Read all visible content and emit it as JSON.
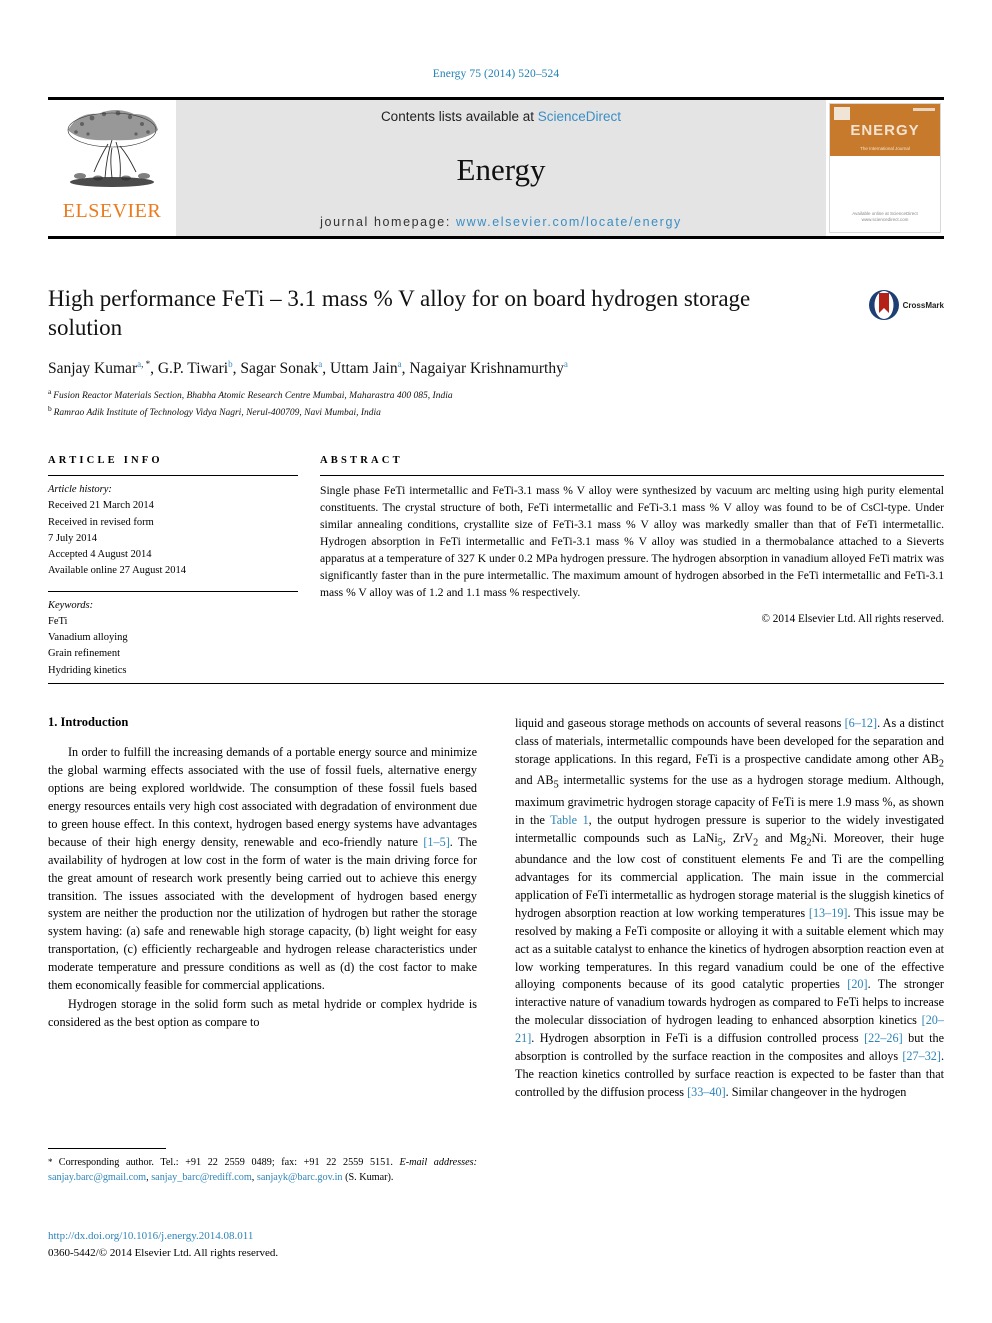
{
  "running_head": "Energy 75 (2014) 520–524",
  "masthead": {
    "publisher": "ELSEVIER",
    "contents_prefix": "Contents lists available at ",
    "contents_link": "ScienceDirect",
    "journal_name": "Energy",
    "homepage_prefix": "journal homepage: ",
    "homepage_url": "www.elsevier.com/locate/energy",
    "cover": {
      "title": "ENERGY",
      "subtitle": "The International Journal",
      "footer": "Available online at\nScienceDirect\nwww.sciencedirect.com"
    }
  },
  "article": {
    "title": "High performance FeTi – 3.1 mass % V alloy for on board hydrogen storage solution",
    "crossmark_label": "CrossMark",
    "authors": [
      {
        "name": "Sanjay Kumar",
        "sup": "a",
        "star": true
      },
      {
        "name": "G.P. Tiwari",
        "sup": "b",
        "star": false
      },
      {
        "name": "Sagar Sonak",
        "sup": "a",
        "star": false
      },
      {
        "name": "Uttam Jain",
        "sup": "a",
        "star": false
      },
      {
        "name": "Nagaiyar Krishnamurthy",
        "sup": "a",
        "star": false
      }
    ],
    "affiliations": [
      {
        "mark": "a",
        "text": "Fusion Reactor Materials Section, Bhabha Atomic Research Centre Mumbai, Maharastra 400 085, India"
      },
      {
        "mark": "b",
        "text": "Ramrao Adik Institute of Technology Vidya Nagri, Nerul-400709, Navi Mumbai, India"
      }
    ]
  },
  "article_info": {
    "heading": "ARTICLE INFO",
    "history_label": "Article history:",
    "history": [
      "Received 21 March 2014",
      "Received in revised form",
      "7 July 2014",
      "Accepted 4 August 2014",
      "Available online 27 August 2014"
    ],
    "keywords_label": "Keywords:",
    "keywords": [
      "FeTi",
      "Vanadium alloying",
      "Grain refinement",
      "Hydriding kinetics"
    ]
  },
  "abstract": {
    "heading": "ABSTRACT",
    "text": "Single phase FeTi intermetallic and FeTi-3.1 mass % V alloy were synthesized by vacuum arc melting using high purity elemental constituents. The crystal structure of both, FeTi intermetallic and FeTi-3.1 mass % V alloy was found to be of CsCl-type. Under similar annealing conditions, crystallite size of FeTi-3.1 mass % V alloy was markedly smaller than that of FeTi intermetallic. Hydrogen absorption in FeTi intermetallic and FeTi-3.1 mass % V alloy was studied in a thermobalance attached to a Sieverts apparatus at a temperature of 327 K under 0.2 MPa hydrogen pressure. The hydrogen absorption in vanadium alloyed FeTi matrix was significantly faster than in the pure intermetallic. The maximum amount of hydrogen absorbed in the FeTi intermetallic and FeTi-3.1 mass % V alloy was of 1.2 and 1.1 mass % respectively.",
    "copyright": "© 2014 Elsevier Ltd. All rights reserved."
  },
  "body": {
    "section_title": "1. Introduction",
    "left_paragraphs": [
      "In order to fulfill the increasing demands of a portable energy source and minimize the global warming effects associated with the use of fossil fuels, alternative energy options are being explored worldwide. The consumption of these fossil fuels based energy resources entails very high cost associated with degradation of environment due to green house effect. In this context, hydrogen based energy systems have advantages because of their high energy density, renewable and eco-friendly nature [1–5]. The availability of hydrogen at low cost in the form of water is the main driving force for the great amount of research work presently being carried out to achieve this energy transition. The issues associated with the development of hydrogen based energy system are neither the production nor the utilization of hydrogen but rather the storage system having: (a) safe and renewable high storage capacity, (b) light weight for easy transportation, (c) efficiently rechargeable and hydrogen release characteristics under moderate temperature and pressure conditions as well as (d) the cost factor to make them economically feasible for commercial applications.",
      "Hydrogen storage in the solid form such as metal hydride or complex hydride is considered as the best option as compare to"
    ],
    "right_paragraphs": [
      "liquid and gaseous storage methods on accounts of several reasons [6–12]. As a distinct class of materials, intermetallic compounds have been developed for the separation and storage applications. In this regard, FeTi is a prospective candidate among other AB2 and AB5 intermetallic systems for the use as a hydrogen storage medium. Although, maximum gravimetric hydrogen storage capacity of FeTi is mere 1.9 mass %, as shown in the Table 1, the output hydrogen pressure is superior to the widely investigated intermetallic compounds such as LaNi5, ZrV2 and Mg2Ni. Moreover, their huge abundance and the low cost of constituent elements Fe and Ti are the compelling advantages for its commercial application. The main issue in the commercial application of FeTi intermetallic as hydrogen storage material is the sluggish kinetics of hydrogen absorption reaction at low working temperatures [13–19]. This issue may be resolved by making a FeTi composite or alloying it with a suitable element which may act as a suitable catalyst to enhance the kinetics of hydrogen absorption reaction even at low working temperatures. In this regard vanadium could be one of the effective alloying components because of its good catalytic properties [20]. The stronger interactive nature of vanadium towards hydrogen as compared to FeTi helps to increase the molecular dissociation of hydrogen leading to enhanced absorption kinetics [20–21]. Hydrogen absorption in FeTi is a diffusion controlled process [22–26] but the absorption is controlled by the surface reaction in the composites and alloys [27–32]. The reaction kinetics controlled by surface reaction is expected to be faster than that controlled by the diffusion process [33–40]. Similar changeover in the hydrogen"
    ]
  },
  "footnotes": {
    "corresponding": "Corresponding author. Tel.: +91 22 2559 0489; fax: +91 22 2559 5151.",
    "email_label": "E-mail addresses:",
    "emails": [
      "sanjay.barc@gmail.com",
      "sanjay_barc@rediff.com",
      "sanjayk@barc.gov.in"
    ],
    "email_owner": "(S. Kumar).",
    "doi": "http://dx.doi.org/10.1016/j.energy.2014.08.011",
    "issn_line": "0360-5442/© 2014 Elsevier Ltd. All rights reserved."
  },
  "colors": {
    "link": "#2e84b8",
    "elsevier_orange": "#eb7b1e",
    "banner_gray": "#e4e4e4",
    "cover_orange": "#c87a2c"
  }
}
